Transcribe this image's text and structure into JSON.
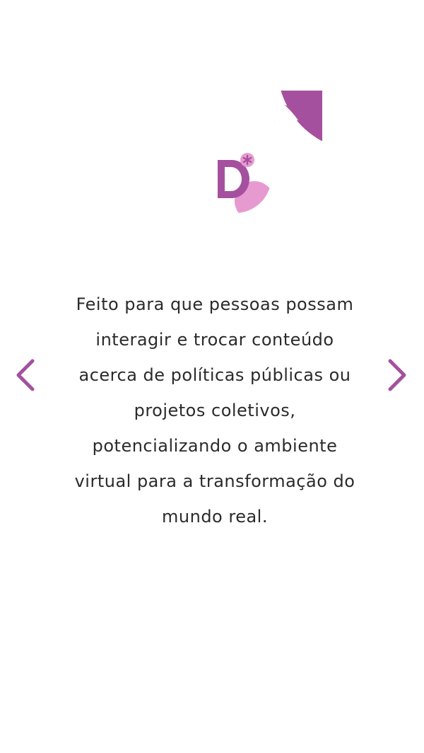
{
  "slide": {
    "description": "Feito para que pessoas possam interagir e trocar conteúdo acerca de políticas públicas ou projetos coletivos, potencializando o ambiente virtual para a transformação do mundo real.",
    "logo_icon": "d-asterisk-logo-icon"
  },
  "navigation": {
    "prev_icon": "chevron-left-icon",
    "next_icon": "chevron-right-icon"
  },
  "colors": {
    "primary": "#a5509f",
    "accent_pink": "#e79ad0",
    "text": "#2b2b2b",
    "background": "#ffffff"
  }
}
